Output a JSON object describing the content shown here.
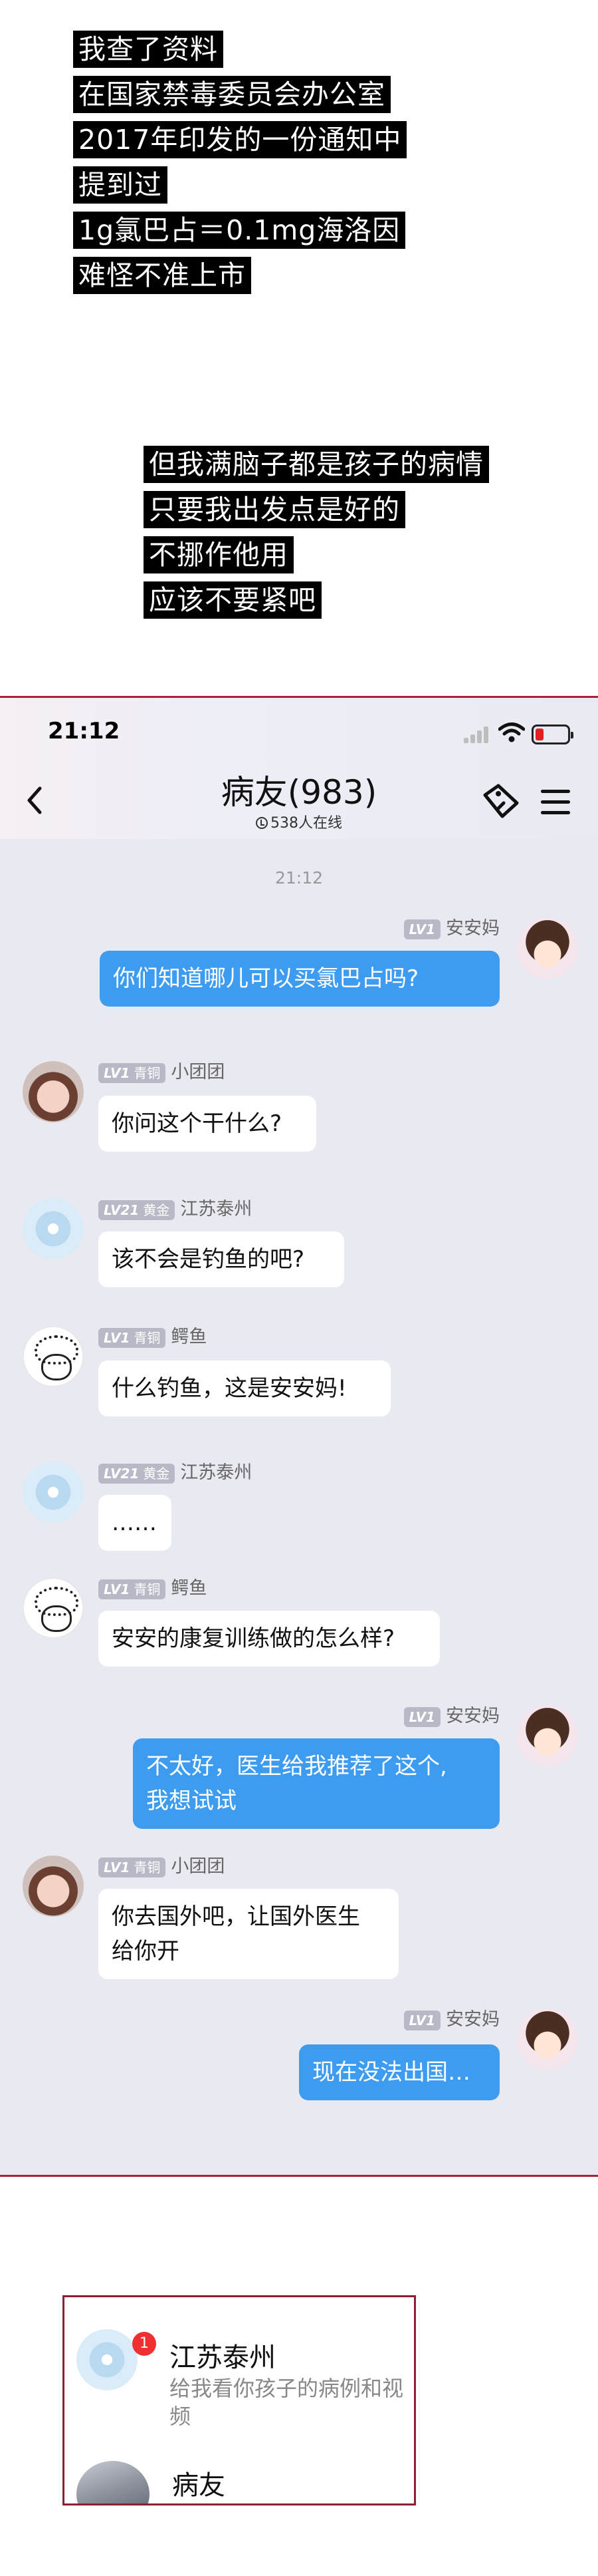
{
  "caption_top": [
    "我查了资料",
    "在国家禁毒委员会办公室",
    "2017年印发的一份通知中",
    "提到过",
    "1g氯巴占＝0.1mg海洛因",
    "难怪不准上市"
  ],
  "caption_mid": [
    "但我满脑子都是孩子的病情",
    "只要我出发点是好的",
    "不挪作他用",
    "应该不要紧吧"
  ],
  "status_bar": {
    "time": "21:12"
  },
  "chat_header": {
    "title": "病友",
    "member_count": "(983)",
    "online": "538人在线"
  },
  "timestamp": "21:12",
  "messages": [
    {
      "sender": "安安妈",
      "level": "LV1",
      "rank": "",
      "text": "你们知道哪儿可以买氯巴占吗?",
      "side": "out"
    },
    {
      "sender": "小团团",
      "level": "LV1",
      "rank": "青铜",
      "text": "你问这个干什么?",
      "side": "in"
    },
    {
      "sender": "江苏泰州",
      "level": "LV21",
      "rank": "黄金",
      "text": "该不会是钓鱼的吧?",
      "side": "in"
    },
    {
      "sender": "鳄鱼",
      "level": "LV1",
      "rank": "青铜",
      "text": "什么钓鱼，这是安安妈!",
      "side": "in"
    },
    {
      "sender": "江苏泰州",
      "level": "LV21",
      "rank": "黄金",
      "text": "……",
      "side": "in"
    },
    {
      "sender": "鳄鱼",
      "level": "LV1",
      "rank": "青铜",
      "text": "安安的康复训练做的怎么样?",
      "side": "in"
    },
    {
      "sender": "安安妈",
      "level": "LV1",
      "rank": "",
      "text_lines": [
        "不太好，医生给我推荐了这个,",
        "我想试试"
      ],
      "side": "out"
    },
    {
      "sender": "小团团",
      "level": "LV1",
      "rank": "青铜",
      "text_lines": [
        "你去国外吧，让国外医生",
        "给你开"
      ],
      "side": "in"
    },
    {
      "sender": "安安妈",
      "level": "LV1",
      "rank": "",
      "text": "现在没法出国…",
      "side": "out"
    }
  ],
  "notifications": [
    {
      "title": "江苏泰州",
      "badge": "1",
      "preview": "给我看你孩子的病例和视频"
    },
    {
      "title": "病友"
    }
  ],
  "colors": {
    "bubble_out": "#3d9cf0",
    "chat_bg": "#e9e9f1",
    "frame": "#a8223a",
    "badge": "#f03030"
  }
}
